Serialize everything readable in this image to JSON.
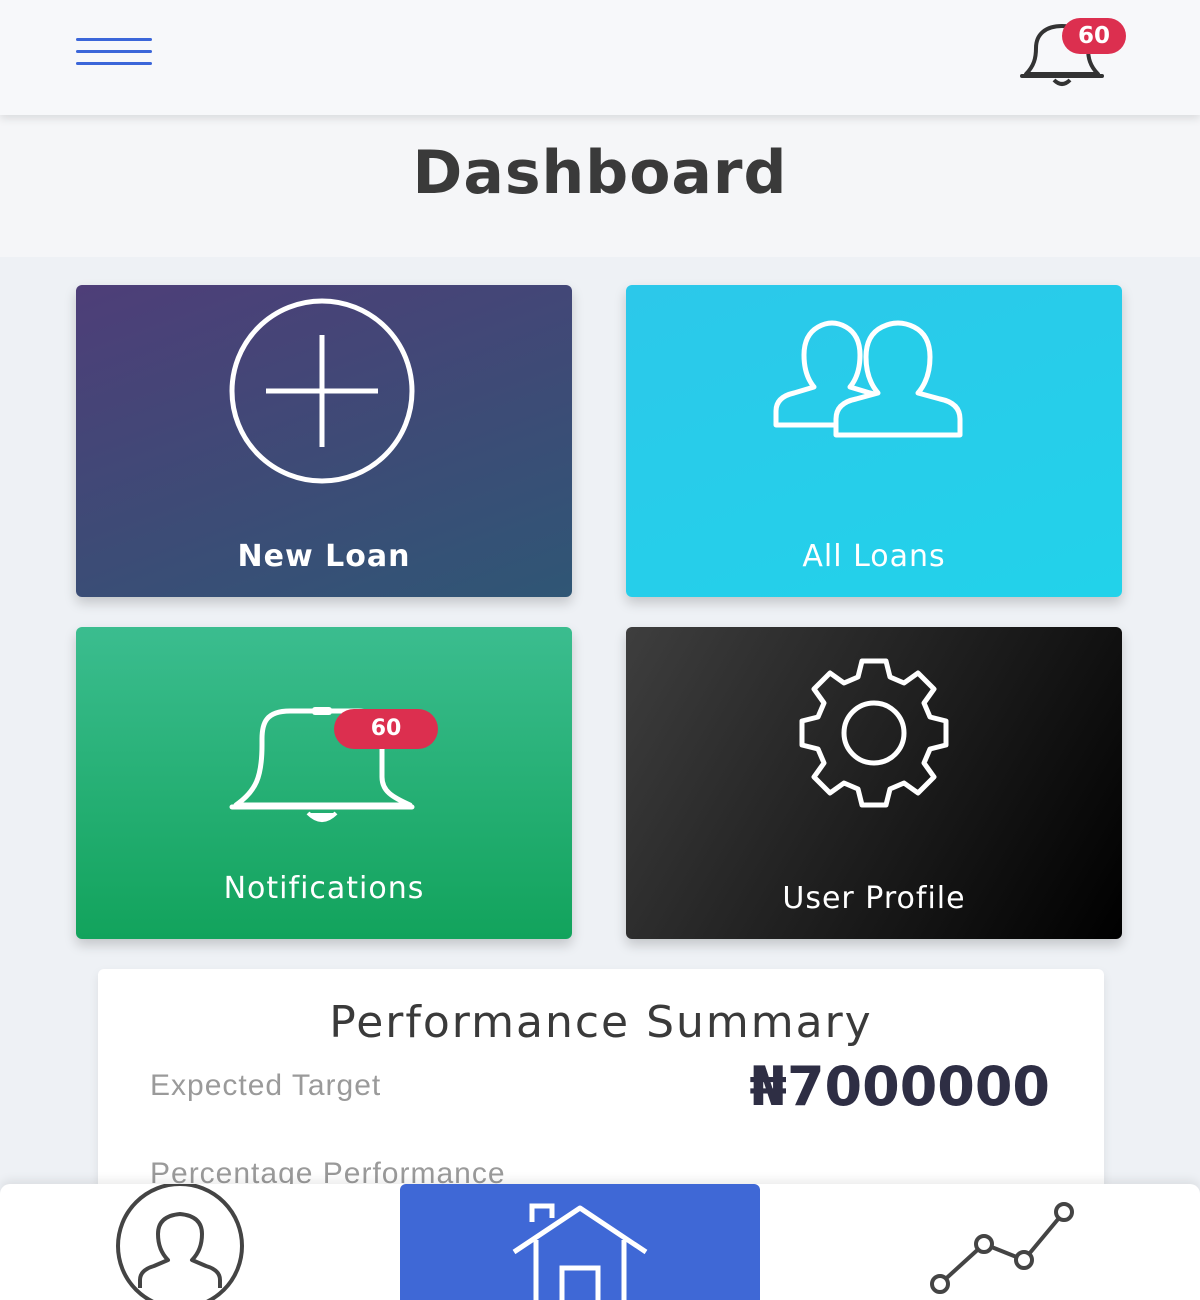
{
  "header": {
    "menu_icon": "hamburger-icon",
    "notification_icon": "bell-icon",
    "notification_count": "60",
    "accent_color": "#3b66d9",
    "badge_color": "#dc2f4f"
  },
  "page": {
    "title": "Dashboard"
  },
  "tiles": [
    {
      "label": "New Loan",
      "icon": "plus-circle-icon"
    },
    {
      "label": "All Loans",
      "icon": "users-icon"
    },
    {
      "label": "Notifications",
      "icon": "bell-icon",
      "badge": "60"
    },
    {
      "label": "User Profile",
      "icon": "gear-icon"
    }
  ],
  "summary": {
    "title": "Performance Summary",
    "expected_label": "Expected Target",
    "expected_value": "₦7000000",
    "percentage_label": "Percentage Performance"
  },
  "bottom_nav": [
    {
      "icon": "user-icon"
    },
    {
      "icon": "home-icon",
      "active": true
    },
    {
      "icon": "chart-line-icon"
    }
  ]
}
